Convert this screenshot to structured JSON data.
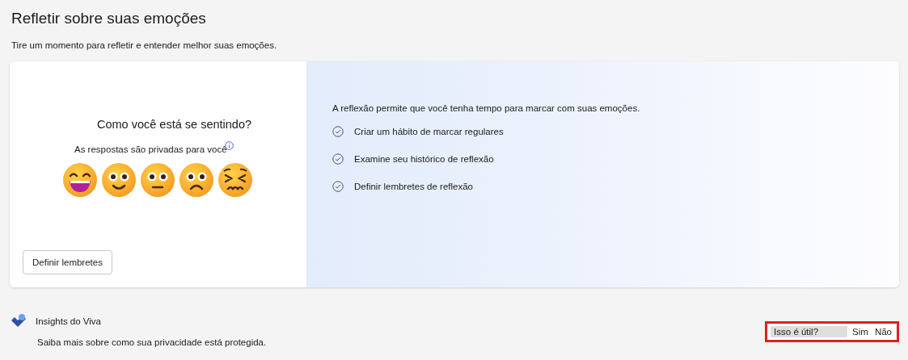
{
  "title": "Refletir sobre suas emoções",
  "subtitle": "Tire um momento para refletir e entender melhor suas emoções.",
  "checkin": {
    "question": "Como você está se sentindo?",
    "privacy_note": "As respostas são privadas para você",
    "moods": [
      {
        "kind": "grinning"
      },
      {
        "kind": "smiling"
      },
      {
        "kind": "neutral"
      },
      {
        "kind": "frowning"
      },
      {
        "kind": "distressed"
      }
    ],
    "reminder_button": "Definir lembretes"
  },
  "benefits": {
    "intro": "A reflexão permite que você tenha tempo para marcar com suas emoções.",
    "items": [
      "Criar um hábito de marcar regulares",
      "Examine seu histórico de reflexão",
      "Definir lembretes de reflexão"
    ]
  },
  "footer": {
    "brand": "Insights do Viva",
    "privacy_link": "Saiba mais sobre como sua privacidade está protegida."
  },
  "feedback": {
    "question": "Isso é útil?",
    "yes": "Sim",
    "no": "Não",
    "highlighted": true
  }
}
